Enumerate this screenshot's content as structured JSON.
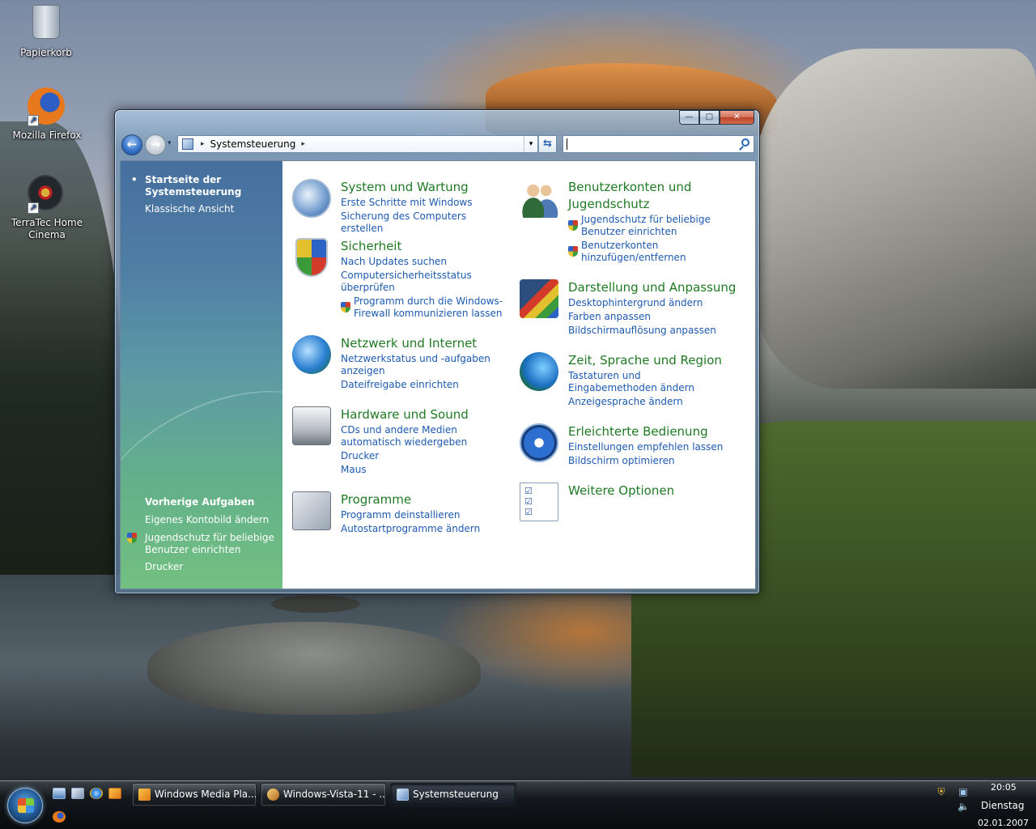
{
  "desktop": {
    "icons": [
      {
        "label": "Papierkorb",
        "icon": "recycle-bin-icon"
      },
      {
        "label": "Mozilla Firefox",
        "icon": "firefox-icon"
      },
      {
        "label": "TerraTec Home Cinema",
        "icon": "terratec-icon"
      }
    ]
  },
  "window": {
    "controls": {
      "minimize": "—",
      "maximize": "□",
      "close": "✕"
    },
    "nav": {
      "back": "←",
      "forward": "→",
      "recent": "▾"
    },
    "address": {
      "breadcrumb": "Systemsteuerung",
      "separator": "▸",
      "dropdown": "▾"
    },
    "refresh": "⇆",
    "search": {
      "value": "",
      "placeholder": ""
    }
  },
  "left_pane": {
    "home": "Startseite der Systemsteuerung",
    "classic": "Klassische Ansicht",
    "recent_title": "Vorherige Aufgaben",
    "recent_items": [
      {
        "label": "Eigenes Kontobild ändern",
        "shield": false
      },
      {
        "label": "Jugendschutz für beliebige Benutzer einrichten",
        "shield": true
      },
      {
        "label": "Drucker",
        "shield": false
      }
    ]
  },
  "categories": {
    "system": {
      "title": "System und Wartung",
      "links": [
        "Erste Schritte mit Windows",
        "Sicherung des Computers erstellen"
      ]
    },
    "security": {
      "title": "Sicherheit",
      "links": [
        "Nach Updates suchen",
        "Computersicherheitsstatus überprüfen",
        "Programm durch die Windows-Firewall kommunizieren lassen"
      ]
    },
    "network": {
      "title": "Netzwerk und Internet",
      "links": [
        "Netzwerkstatus und -aufgaben anzeigen",
        "Dateifreigabe einrichten"
      ]
    },
    "hardware": {
      "title": "Hardware und Sound",
      "links": [
        "CDs und andere Medien automatisch wiedergeben",
        "Drucker",
        "Maus"
      ]
    },
    "programs": {
      "title": "Programme",
      "links": [
        "Programm deinstallieren",
        "Autostartprogramme ändern"
      ]
    },
    "users": {
      "title": "Benutzerkonten und Jugendschutz",
      "links": [
        "Jugendschutz für beliebige Benutzer einrichten",
        "Benutzerkonten hinzufügen/entfernen"
      ]
    },
    "appearance": {
      "title": "Darstellung und Anpassung",
      "links": [
        "Desktophintergrund ändern",
        "Farben anpassen",
        "Bildschirmauflösung anpassen"
      ]
    },
    "clock": {
      "title": "Zeit, Sprache und Region",
      "links": [
        "Tastaturen und Eingabemethoden ändern",
        "Anzeigesprache ändern"
      ]
    },
    "ease": {
      "title": "Erleichterte Bedienung",
      "links": [
        "Einstellungen empfehlen lassen",
        "Bildschirm optimieren"
      ]
    },
    "more": {
      "title": "Weitere Optionen"
    }
  },
  "taskbar": {
    "buttons": [
      {
        "label": "Windows Media Pla...",
        "active": false
      },
      {
        "label": "Windows-Vista-11 - ...",
        "active": false
      },
      {
        "label": "Systemsteuerung",
        "active": true
      }
    ],
    "clock": {
      "time": "20:05",
      "day": "Dienstag",
      "date": "02.01.2007"
    }
  }
}
